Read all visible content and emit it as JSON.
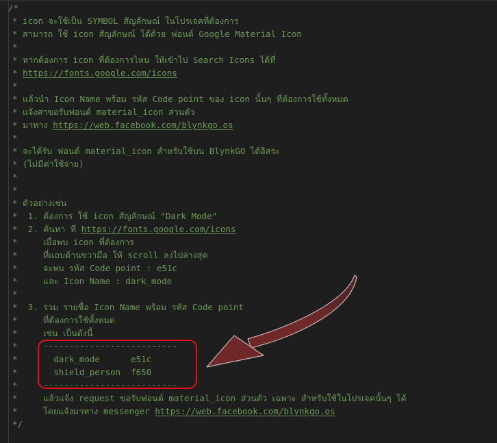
{
  "editor": {
    "lines": [
      {
        "text": "/*"
      },
      {
        "text": "* icon จะใช้เป็น SYMBOL สัญลักษณ์ ในโปรเจคที่ต้องการ"
      },
      {
        "text": "* สามารถ ใช้ icon สัญลักษณ์ ได้ด้วย ฟอนต์ Google Material Icon"
      },
      {
        "text": "*"
      },
      {
        "text": "* หากต้องการ icon ที่ต้องการไหน ให้เข้าไป Search Icons ได้ที่"
      },
      {
        "text": "* ",
        "link": "https://fonts.google.com/icons"
      },
      {
        "text": "*"
      },
      {
        "text": "* แล้วนำ Icon Name พร้อม รหัส Code point ของ icon นั้นๆ ที่ต้องการใช้ทั้งหมด"
      },
      {
        "text": "* แจ้งศาขอรับฟอนต์ material_icon ส่วนตัว"
      },
      {
        "text": "* มาทาง ",
        "link": "https://web.facebook.com/blynkgo.os"
      },
      {
        "text": "*"
      },
      {
        "text": "* จะได้รับ ฟอนต์ material_icon สำหรับใช้บน BlynkGO ได้อิสระ"
      },
      {
        "text": "* (ไม่มีค่าใช้จ่าย)"
      },
      {
        "text": "*"
      },
      {
        "text": "*"
      },
      {
        "text": "* ตัวอย่างเช่น"
      },
      {
        "text": "*  1. ต้องการ ใช้ icon สัญลักษณ์ \"Dark Mode\""
      },
      {
        "text": "*  2. ค้นหา ที่ ",
        "link": "https://fonts.google.com/icons"
      },
      {
        "text": "*     เมื่อพบ icon ที่ต้องการ"
      },
      {
        "text": "*     ที่แถบด้านขวามือ ให้ scroll ลงไปล่างสุด"
      },
      {
        "text": "*     จะพบ รหัส Code point : e51c"
      },
      {
        "text": "*     และ Icon Name : dark_mode"
      },
      {
        "text": "*"
      },
      {
        "text": "*  3. รวม รายชื่อ Icon Name พร้อม รหัส Code point"
      },
      {
        "text": "*     ที่ต้องการใช้ทั้งหมด"
      },
      {
        "text": "*     เช่น เป็นดังนี้"
      },
      {
        "text": "*     --------------------------"
      },
      {
        "text": "*       dark_mode      e51c"
      },
      {
        "text": "*       shield_person  f650"
      },
      {
        "text": "*     --------------------------"
      },
      {
        "text": "*     แล้วแจ้ง request ขอรับฟอนต์ material_icon ส่วนตัว เฉพาะ สำหรับใช้ในโปรเจคนั้นๆ ได้"
      },
      {
        "text": "*     โดยแจ้งมาทาง messenger ",
        "link": "https://web.facebook.com/blynkgo.os"
      },
      {
        "text": "*/"
      }
    ]
  },
  "colors": {
    "background": "#1e1e1e",
    "comment": "#6a9955",
    "highlight_box": "#e0101a",
    "arrow": "#7a2e2e"
  },
  "annotation": {
    "highlight": "highlight-box",
    "arrow_icon": "curved-arrow-icon"
  }
}
